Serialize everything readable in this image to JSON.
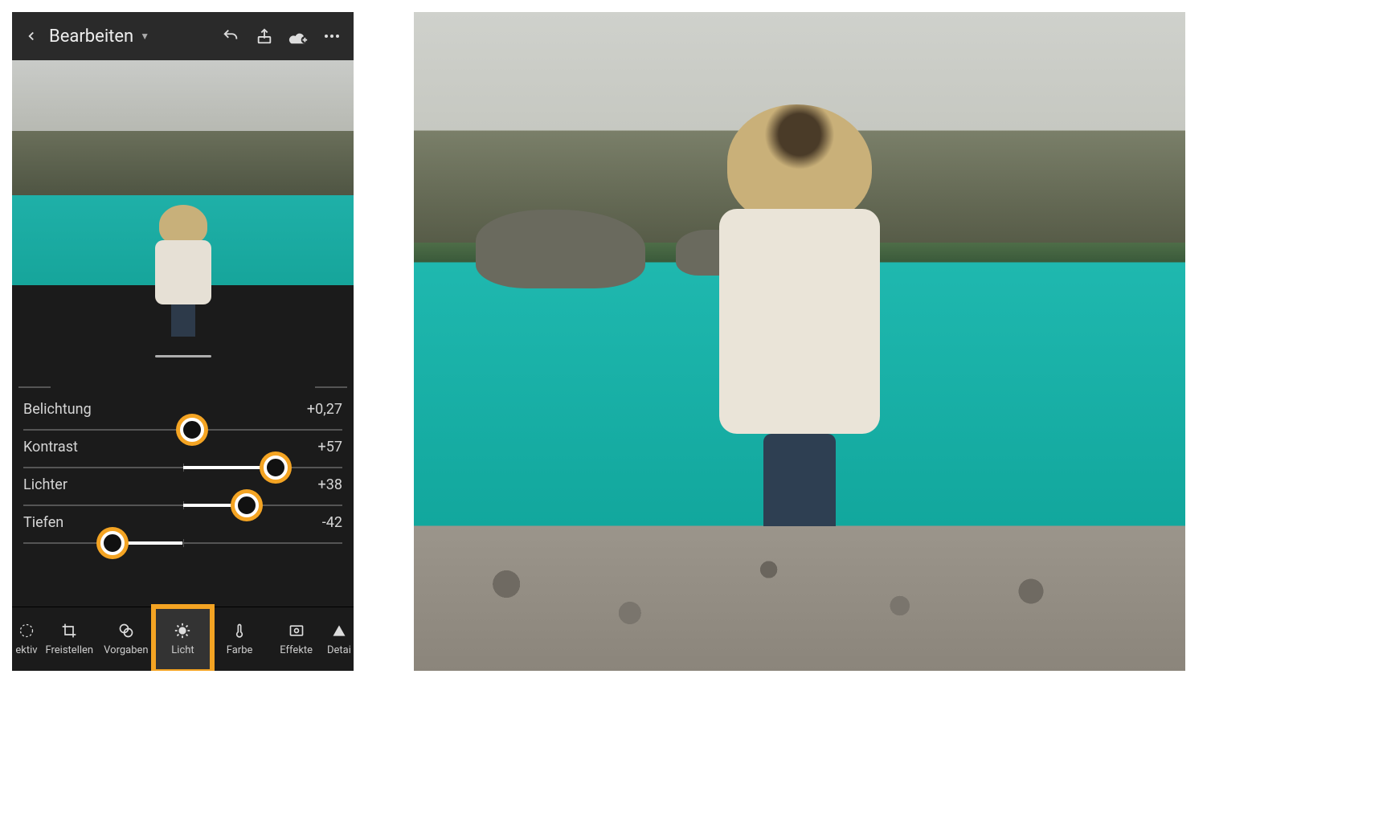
{
  "header": {
    "title": "Bearbeiten",
    "icons": {
      "back": "back-icon",
      "undo": "undo-icon",
      "share": "share-icon",
      "cloud": "cloud-add-icon",
      "more": "more-icon"
    }
  },
  "sliders": [
    {
      "label": "Belichtung",
      "value": "+0,27",
      "pos_pct": 53
    },
    {
      "label": "Kontrast",
      "value": "+57",
      "pos_pct": 79
    },
    {
      "label": "Lichter",
      "value": "+38",
      "pos_pct": 70
    },
    {
      "label": "Tiefen",
      "value": "-42",
      "pos_pct": 28
    }
  ],
  "tabs": [
    {
      "id": "selektiv",
      "label": "ektiv",
      "icon": "target-icon",
      "partial": true
    },
    {
      "id": "freistellen",
      "label": "Freistellen",
      "icon": "crop-icon"
    },
    {
      "id": "vorgaben",
      "label": "Vorgaben",
      "icon": "presets-icon"
    },
    {
      "id": "licht",
      "label": "Licht",
      "icon": "light-icon",
      "active": true,
      "highlight": true
    },
    {
      "id": "farbe",
      "label": "Farbe",
      "icon": "thermometer-icon"
    },
    {
      "id": "effekte",
      "label": "Effekte",
      "icon": "vignette-icon"
    },
    {
      "id": "details",
      "label": "Detai",
      "icon": "triangle-icon",
      "partial": true
    }
  ],
  "colors": {
    "accent": "#f4a423",
    "bg": "#1b1b1b",
    "topbar": "#2a2a2a"
  }
}
